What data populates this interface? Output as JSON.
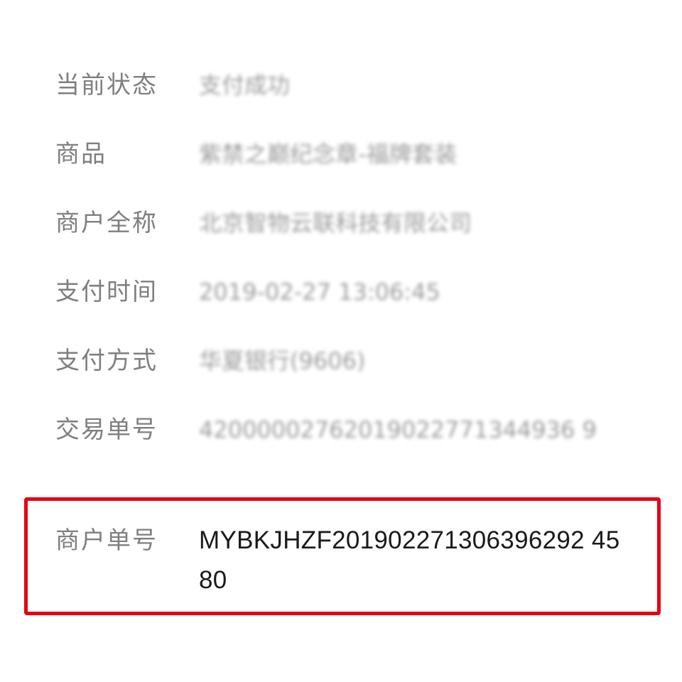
{
  "details": {
    "rows": [
      {
        "label": "当前状态",
        "value": "支付成功"
      },
      {
        "label": "商品",
        "value": "紫禁之巅纪念章-福牌套装"
      },
      {
        "label": "商户全称",
        "value": "北京智物云联科技有限公司"
      },
      {
        "label": "支付时间",
        "value": "2019-02-27 13:06:45"
      },
      {
        "label": "支付方式",
        "value": "华夏银行(9606)"
      },
      {
        "label": "交易单号",
        "value": "42000002762019022771344936 9"
      },
      {
        "label": "商户单号",
        "value": "MYBKJHZF201902271306396292 4580"
      }
    ]
  },
  "colors": {
    "label": "#7f7f7f",
    "value_blurred": "#8a8a8a",
    "value_clear": "#1a1a1a",
    "highlight": "#e60012"
  }
}
